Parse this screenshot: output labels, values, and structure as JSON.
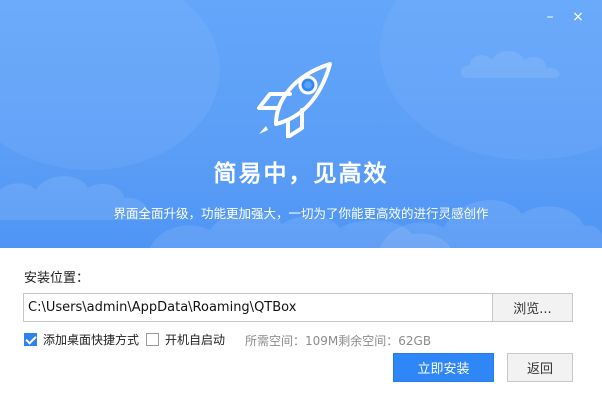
{
  "window": {
    "minimize_glyph": "–",
    "close_glyph": "×"
  },
  "hero": {
    "logo_icon": "rocket-icon",
    "title": "简易中，见高效",
    "subtitle": "界面全面升级，功能更加强大，一切为了你能更高效的进行灵感创作",
    "colors": {
      "gradient_top": "#63a6fa",
      "gradient_bottom": "#4f95f4"
    }
  },
  "install": {
    "path_label": "安装位置：",
    "path_value": "C:\\Users\\admin\\AppData\\Roaming\\QTBox",
    "browse_label": "浏览...",
    "options": {
      "desktop_shortcut": {
        "label": "添加桌面快捷方式",
        "checked": true
      },
      "auto_start": {
        "label": "开机自启动",
        "checked": false
      }
    },
    "space_info": "所需空间：109M剩余空间：62GB",
    "install_label": "立即安装",
    "back_label": "返回",
    "accent_color": "#2f86f6"
  }
}
